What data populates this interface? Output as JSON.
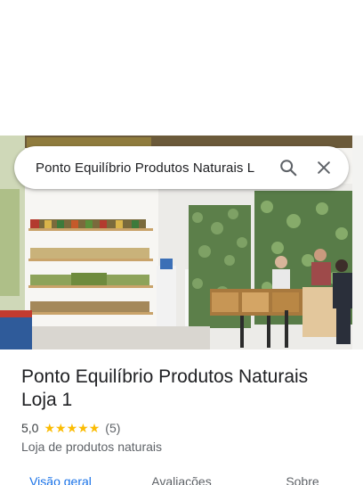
{
  "search": {
    "query": "Ponto Equilíbrio Produtos Naturais L"
  },
  "place": {
    "name": "Ponto Equilíbrio Produtos Naturais Loja 1",
    "rating": "5,0",
    "review_count": "(5)",
    "stars_shown": 5,
    "category": "Loja de produtos naturais"
  },
  "tabs": [
    {
      "label": "Visão geral",
      "active": true
    },
    {
      "label": "Avaliações",
      "active": false
    },
    {
      "label": "Sobre",
      "active": false
    }
  ],
  "colors": {
    "accent": "#1a73e8",
    "star": "#fbbc04",
    "text": "#202124",
    "secondary": "#5f6368"
  },
  "icons": [
    "search-icon",
    "close-icon",
    "star-icon"
  ]
}
